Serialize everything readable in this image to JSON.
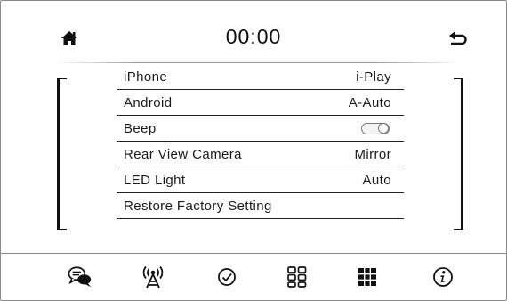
{
  "header": {
    "home_icon": "home-icon",
    "time": "00:00",
    "back_icon": "back-arrow-icon"
  },
  "settings": [
    {
      "label": "iPhone",
      "value": "i-Play"
    },
    {
      "label": "Android",
      "value": "A-Auto"
    },
    {
      "label": "Beep",
      "value": "",
      "control": "toggle",
      "toggle_on": false
    },
    {
      "label": "Rear View Camera",
      "value": "Mirror"
    },
    {
      "label": "LED Light",
      "value": "Auto"
    },
    {
      "label": "Restore Factory Setting",
      "value": ""
    }
  ],
  "dock": {
    "items": [
      "chat-bubbles-icon",
      "wireless-antenna-icon",
      "check-circle-icon",
      "apps-grid-icon",
      "keypad-grid-icon",
      "info-icon"
    ]
  },
  "colors": {
    "text": "#1a1a1a",
    "divider": "#9a9a9a",
    "background": "#ffffff"
  }
}
